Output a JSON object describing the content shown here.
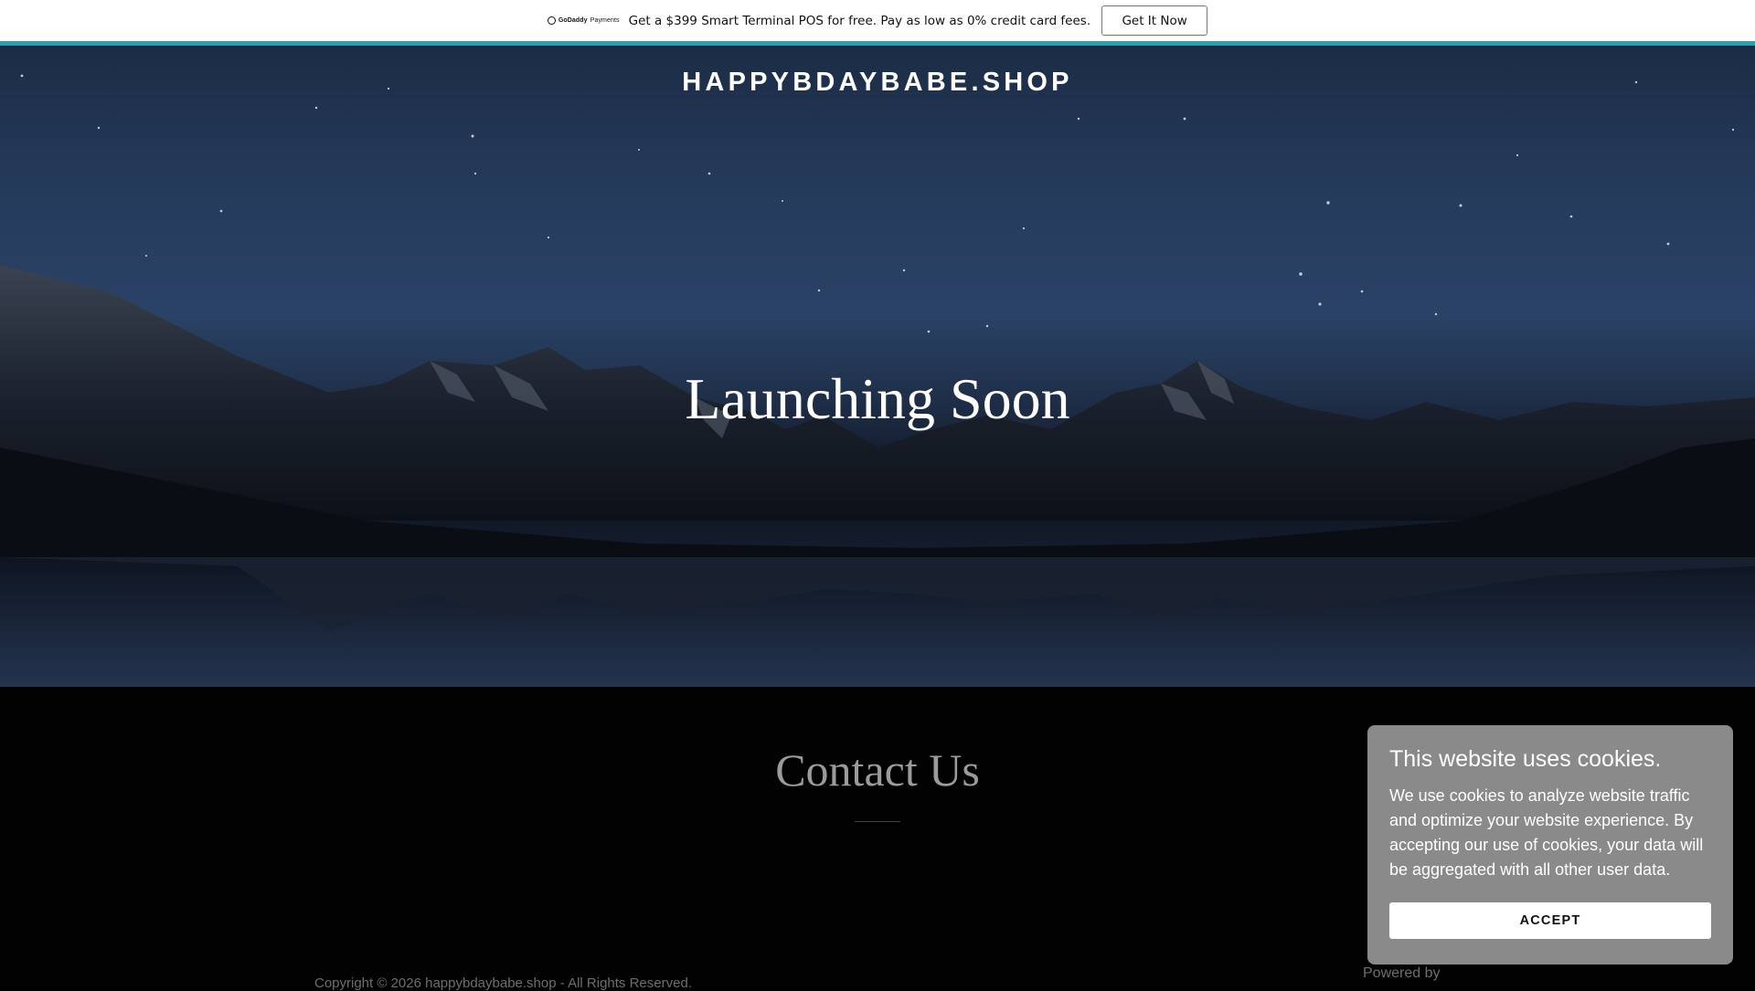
{
  "promo": {
    "logo_brand": "GoDaddy",
    "logo_product": "Payments",
    "text": "Get a $399 Smart Terminal POS for free. Pay as low as 0% credit card fees.",
    "button_label": "Get It Now",
    "accent_color": "#1ba8b3"
  },
  "header": {
    "site_title": "HAPPYBDAYBABE.SHOP"
  },
  "hero": {
    "heading": "Launching Soon"
  },
  "contact": {
    "heading": "Contact Us"
  },
  "footer": {
    "copyright": "Copyright © 2026 happybdaybabe.shop - All Rights Reserved.",
    "powered_by": "Powered by"
  },
  "cookie_banner": {
    "title": "This website uses cookies.",
    "body": "We use cookies to analyze website traffic and optimize your website experience. By accepting our use of cookies, your data will be aggregated with all other user data.",
    "accept_label": "ACCEPT"
  }
}
